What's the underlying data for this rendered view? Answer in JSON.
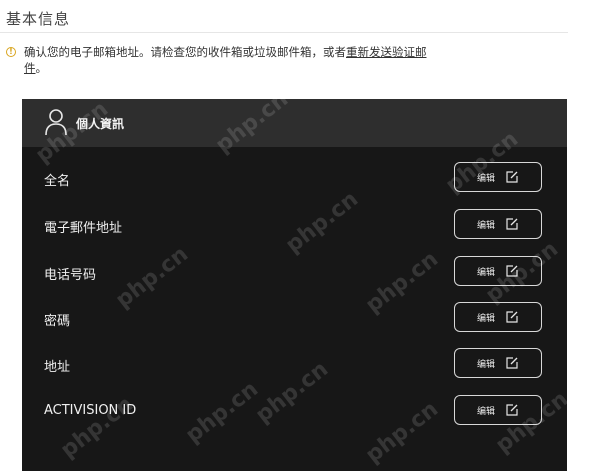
{
  "section": {
    "title": "基本信息"
  },
  "notice": {
    "icon": "warning-circle-icon",
    "text_before": "确认您的电子邮箱地址。请检查您的收件箱或垃圾邮件箱，或者",
    "link_text": "重新发送验证邮件",
    "text_after": "。"
  },
  "panel": {
    "title": "個人資訊",
    "user_icon": "user-icon",
    "rows": [
      {
        "label": "全名",
        "edit_label": "编辑"
      },
      {
        "label": "電子郵件地址",
        "edit_label": "编辑"
      },
      {
        "label": "电话号码",
        "edit_label": "编辑"
      },
      {
        "label": "密碼",
        "edit_label": "编辑"
      },
      {
        "label": "地址",
        "edit_label": "编辑"
      },
      {
        "label": "ACTIVISION ID",
        "edit_label": "编辑"
      }
    ]
  },
  "watermark": {
    "text": "php.cn"
  },
  "colors": {
    "panel_bg": "#171717",
    "header_bg": "#2e2e2e",
    "notice_accent": "#d9a51f"
  }
}
